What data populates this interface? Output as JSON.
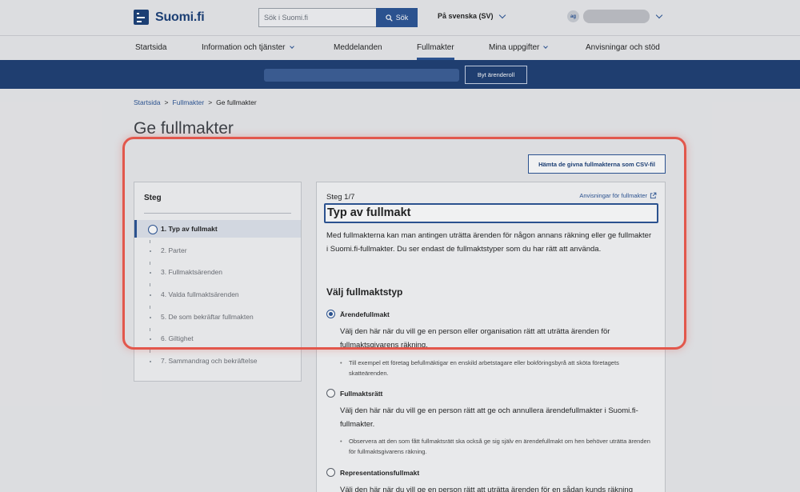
{
  "header": {
    "logo_text": "Suomi.fi",
    "search_placeholder": "Sök i Suomi.fi",
    "search_button": "Sök",
    "language": "På svenska (SV)",
    "avatar_initials": "ag"
  },
  "nav": {
    "items": [
      {
        "label": "Startsida"
      },
      {
        "label": "Information och tjänster"
      },
      {
        "label": "Meddelanden"
      },
      {
        "label": "Fullmakter"
      },
      {
        "label": "Mina uppgifter"
      },
      {
        "label": "Anvisningar och stöd"
      }
    ],
    "active": "Fullmakter"
  },
  "rolebar": {
    "switch_button": "Byt ärenderoll"
  },
  "breadcrumb": {
    "items": [
      "Startsida",
      "Fullmakter",
      "Ge fullmakter"
    ],
    "separator": ">"
  },
  "page": {
    "title": "Ge fullmakter",
    "csv_button": "Hämta de givna fullmakterna som CSV-fil"
  },
  "steps": {
    "title": "Steg",
    "items": [
      {
        "label": "1. Typ av fullmakt",
        "current": true
      },
      {
        "label": "2. Parter",
        "current": false
      },
      {
        "label": "3. Fullmaktsärenden",
        "current": false
      },
      {
        "label": "4. Valda fullmaktsärenden",
        "current": false
      },
      {
        "label": "5. De som bekräftar fullmakten",
        "current": false
      },
      {
        "label": "6. Giltighet",
        "current": false
      },
      {
        "label": "7. Sammandrag och bekräftelse",
        "current": false
      }
    ]
  },
  "content": {
    "step_label": "Steg 1/7",
    "help_link": "Anvisningar för fullmakter",
    "title": "Typ av fullmakt",
    "intro": "Med fullmakterna kan man antingen uträtta ärenden för någon annans räkning eller ge fullmakter i Suomi.fi-fullmakter. Du ser endast de fullmaktstyper som du har rätt att använda.",
    "choose_title": "Välj fullmaktstyp",
    "options": [
      {
        "label": "Ärendefullmakt",
        "checked": true,
        "description": "Välj den här när du vill ge en person eller organisation rätt att uträtta ärenden för fullmaktsgivarens räkning.",
        "note": "Till exempel ett företag befullmäktigar en enskild arbetstagare eller bokföringsbyrå att sköta företagets skatteärenden."
      },
      {
        "label": "Fullmaktsrätt",
        "checked": false,
        "description": "Välj den här när du vill ge en person rätt att ge och annullera ärendefullmakter i Suomi.fi-fullmakter.",
        "note": "Observera att den som fått fullmaktsrätt ska också ge sig själv en ärendefullmakt om hen behöver uträtta ärenden för fullmaktsgivarens räkning."
      },
      {
        "label": "Representationsfullmakt",
        "checked": false,
        "description": "Välj den här när du vill ge en person rätt att uträtta ärenden för en sådan kunds räkning"
      }
    ]
  },
  "colors": {
    "brand": "#1a3e77",
    "accent": "#2a5394",
    "highlight": "#e2574c"
  }
}
